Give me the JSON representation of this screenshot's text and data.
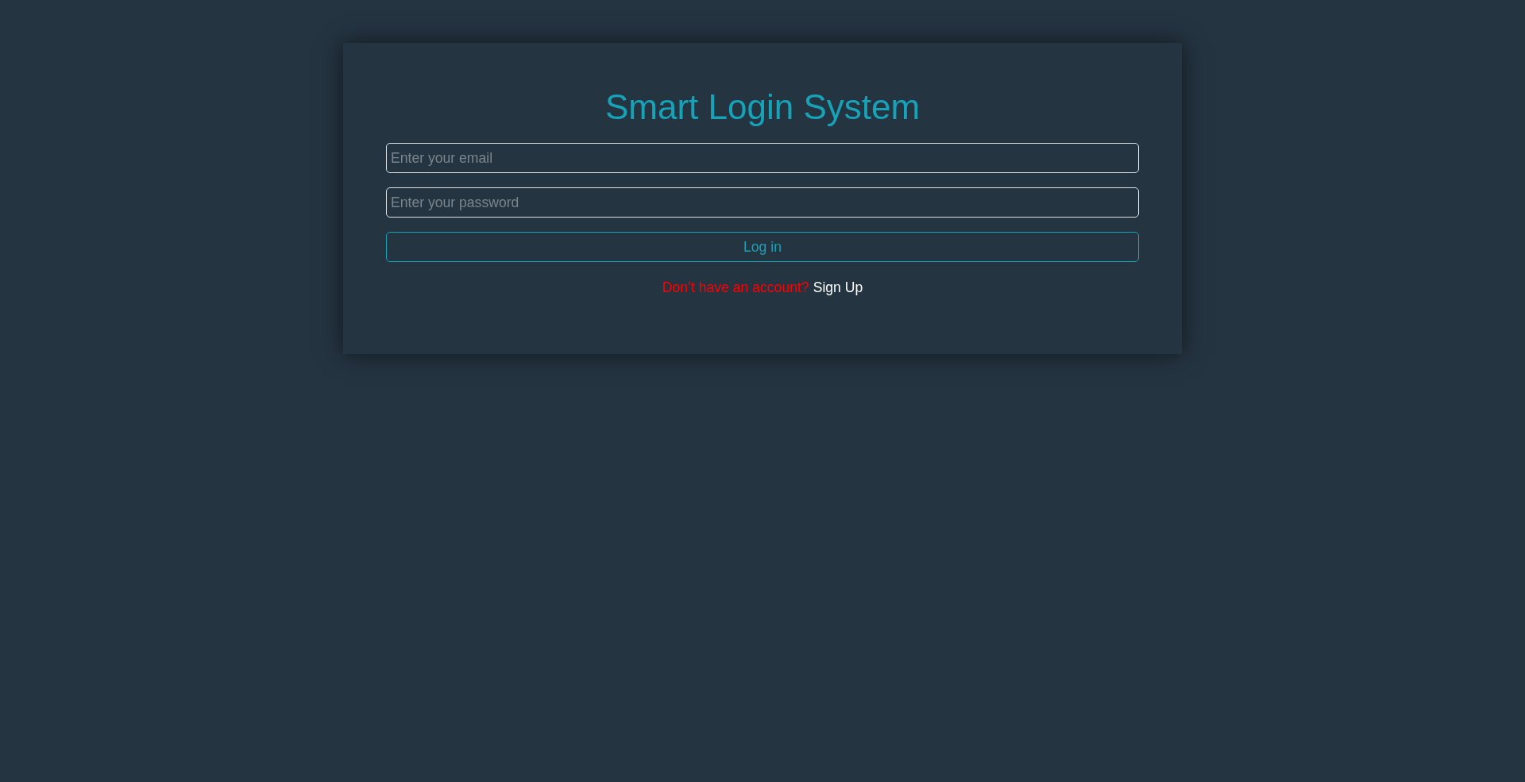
{
  "title": "Smart Login System",
  "email_field": {
    "placeholder": "Enter your email"
  },
  "password_field": {
    "placeholder": "Enter your password"
  },
  "login_button": {
    "label": "Log in"
  },
  "signup_prompt": {
    "text": "Don’t have an account?",
    "link": "Sign Up"
  }
}
